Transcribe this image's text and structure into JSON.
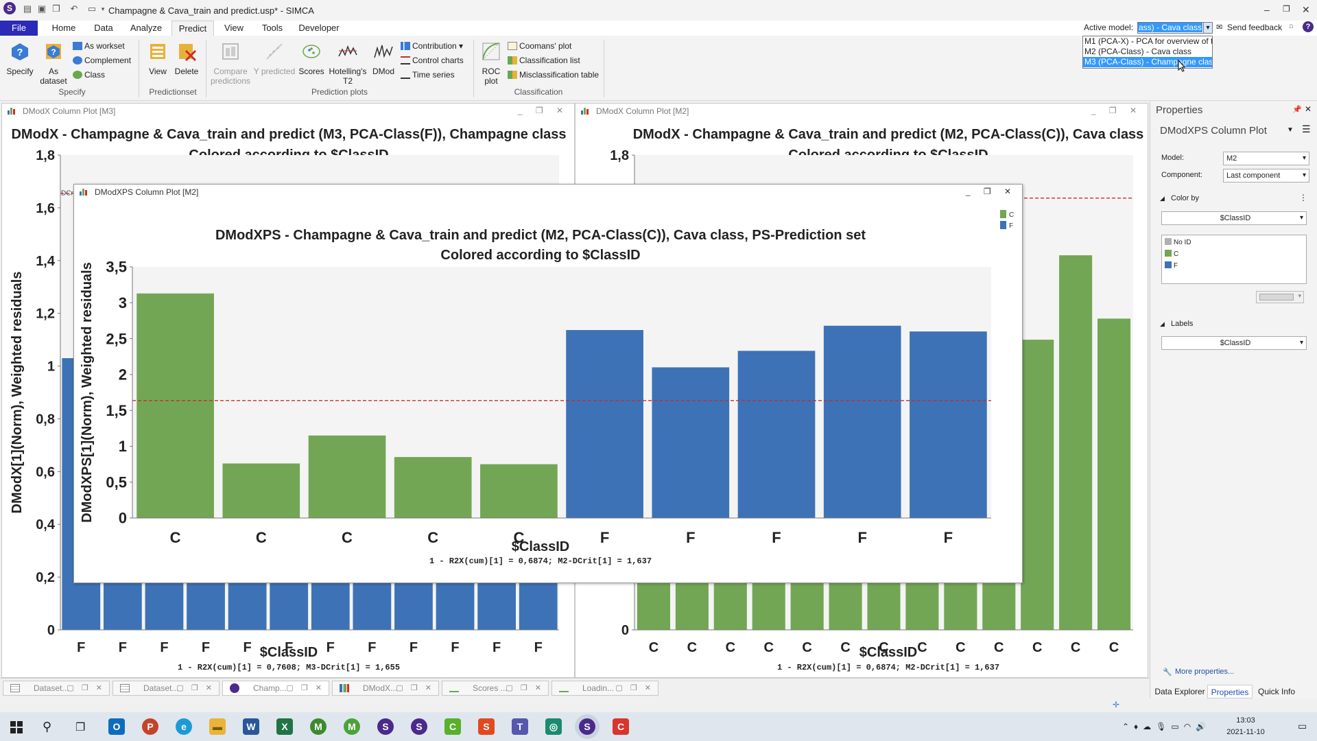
{
  "app": {
    "title": "Champagne & Cava_train and predict.usp* - SIMCA"
  },
  "menu": {
    "items": [
      "File",
      "Home",
      "Data",
      "Analyze",
      "Predict",
      "View",
      "Tools",
      "Developer"
    ]
  },
  "ribbon": {
    "specify": {
      "specify": "Specify",
      "as_dataset": "As",
      "as_dataset2": "dataset",
      "as_workset": "As workset",
      "complement": "Complement",
      "class": "Class",
      "group": "Specify"
    },
    "predictionset": {
      "view": "View",
      "delete": "Delete",
      "group": "Predictionset"
    },
    "plots": {
      "compare": "Compare",
      "compare2": "predictions",
      "ypred": "Y predicted",
      "scores": "Scores",
      "hotelling": "Hotelling's",
      "hotelling2": "T2",
      "dmod": "DMod",
      "contribution": "Contribution",
      "control": "Control charts",
      "timeseries": "Time series",
      "group": "Prediction plots"
    },
    "classification": {
      "roc": "ROC",
      "roc2": "plot",
      "coomans": "Coomans' plot",
      "classlist": "Classification list",
      "misclass": "Misclassification table",
      "group": "Classification"
    }
  },
  "active_model": {
    "label": "Active model:",
    "value": "ass) - Cava class",
    "options": [
      "M1 (PCA-X) - PCA for overview of t",
      "M2 (PCA-Class) - Cava class",
      "M3 (PCA-Class) - Champagne class"
    ],
    "selected_index": 2
  },
  "feedback": "Send feedback",
  "panel_m3": {
    "tab": "DModX Column Plot [M3]",
    "title1": "DModX - Champagne & Cava_train and predict (M3, PCA-Class(F)), Champagne class",
    "title2": "Colored according to $ClassID",
    "ylabel": "DModX[1](Norm), Weighted residuals",
    "xlabel": "$ClassID",
    "footer": "1 - R2X(cum)[1] = 0,7608; M3-DCrit[1] = 1,655",
    "crit_label": "DCr"
  },
  "panel_m2": {
    "tab": "DModX Column Plot [M2]",
    "title1": "DModX - Champagne & Cava_train and predict (M2, PCA-Class(C)), Cava class",
    "title2": "Colored according to $ClassID",
    "xlabel": "$ClassID",
    "footer": "1 - R2X(cum)[1] = 0,6874; M2-DCrit[1] = 1,637"
  },
  "panel_ps": {
    "tab": "DModXPS Column Plot [M2]",
    "title1": "DModXPS - Champagne & Cava_train and predict (M2, PCA-Class(C)), Cava class, PS-Prediction set",
    "title2": "Colored according to $ClassID",
    "ylabel": "DModXPS[1](Norm), Weighted residuals",
    "xlabel": "$ClassID",
    "footer": "1 - R2X(cum)[1] = 0,6874; M2-DCrit[1] = 1,637",
    "legend": [
      "C",
      "F"
    ]
  },
  "properties": {
    "header": "Properties",
    "plot": "DModXPS Column Plot",
    "model_label": "Model:",
    "model": "M2",
    "component_label": "Component:",
    "component": "Last component",
    "colorby": "Color by",
    "colorby_value": "$ClassID",
    "classes": [
      "No ID",
      "C",
      "F"
    ],
    "labels": "Labels",
    "labels_value": "$ClassID",
    "more": "More properties...",
    "tabs": [
      "Data Explorer",
      "Properties",
      "Quick Info"
    ]
  },
  "doc_tabs": [
    "Dataset...",
    "Dataset...",
    "Champ...",
    "DModX...",
    "Scores ...",
    "Loadin..."
  ],
  "clock": {
    "time": "13:03",
    "date": "2021-11-10"
  },
  "colors": {
    "C": "#72a655",
    "F": "#3d72b6",
    "crit": "#cc2b2b",
    "nocls": "#b0b0b0"
  },
  "chart_data": [
    {
      "type": "bar",
      "title": "DModX - Champagne & Cava_train and predict (M3, PCA-Class(F)), Champagne class",
      "subtitle": "Colored according to $ClassID",
      "ylabel": "DModX[1](Norm), Weighted residuals",
      "xlabel": "$ClassID",
      "ylim": [
        0,
        1.8
      ],
      "yticks": [
        0,
        0.2,
        0.4,
        0.6,
        0.8,
        1,
        1.2,
        1.4,
        1.6,
        1.8
      ],
      "critical_limit": 1.655,
      "categories": [
        "F",
        "F",
        "F",
        "F",
        "F",
        "F",
        "F",
        "F",
        "F",
        "F",
        "F",
        "F"
      ],
      "values": [
        1.03,
        1.0,
        1.0,
        1.0,
        1.0,
        1.0,
        1.0,
        1.0,
        1.0,
        1.0,
        1.0,
        1.0
      ]
    },
    {
      "type": "bar",
      "title": "DModX - Champagne & Cava_train and predict (M2, PCA-Class(C)), Cava class",
      "subtitle": "Colored according to $ClassID",
      "ylabel": "",
      "xlabel": "$ClassID",
      "ylim": [
        0,
        1.8
      ],
      "yticks": [
        0,
        1.8
      ],
      "critical_limit": 1.637,
      "categories": [
        "C",
        "C",
        "C",
        "C",
        "C",
        "C",
        "C",
        "C",
        "C",
        "C",
        "C",
        "C",
        "C"
      ],
      "values": [
        0.9,
        0.9,
        0.9,
        0.9,
        0.9,
        0.9,
        0.9,
        0.9,
        0.9,
        0.9,
        1.1,
        1.42,
        1.18
      ]
    },
    {
      "type": "bar",
      "title": "DModXPS - Champagne & Cava_train and predict (M2, PCA-Class(C)), Cava class, PS-Prediction set",
      "subtitle": "Colored according to $ClassID",
      "ylabel": "DModXPS[1](Norm), Weighted residuals",
      "xlabel": "$ClassID",
      "ylim": [
        0,
        3.5
      ],
      "yticks": [
        0,
        0.5,
        1,
        1.5,
        2,
        2.5,
        3,
        3.5
      ],
      "critical_limit": 1.637,
      "legend": [
        "C",
        "F"
      ],
      "categories": [
        "C",
        "C",
        "C",
        "C",
        "C",
        "F",
        "F",
        "F",
        "F",
        "F"
      ],
      "values": [
        3.13,
        0.76,
        1.15,
        0.85,
        0.75,
        2.62,
        2.1,
        2.33,
        2.68,
        2.6
      ]
    }
  ]
}
